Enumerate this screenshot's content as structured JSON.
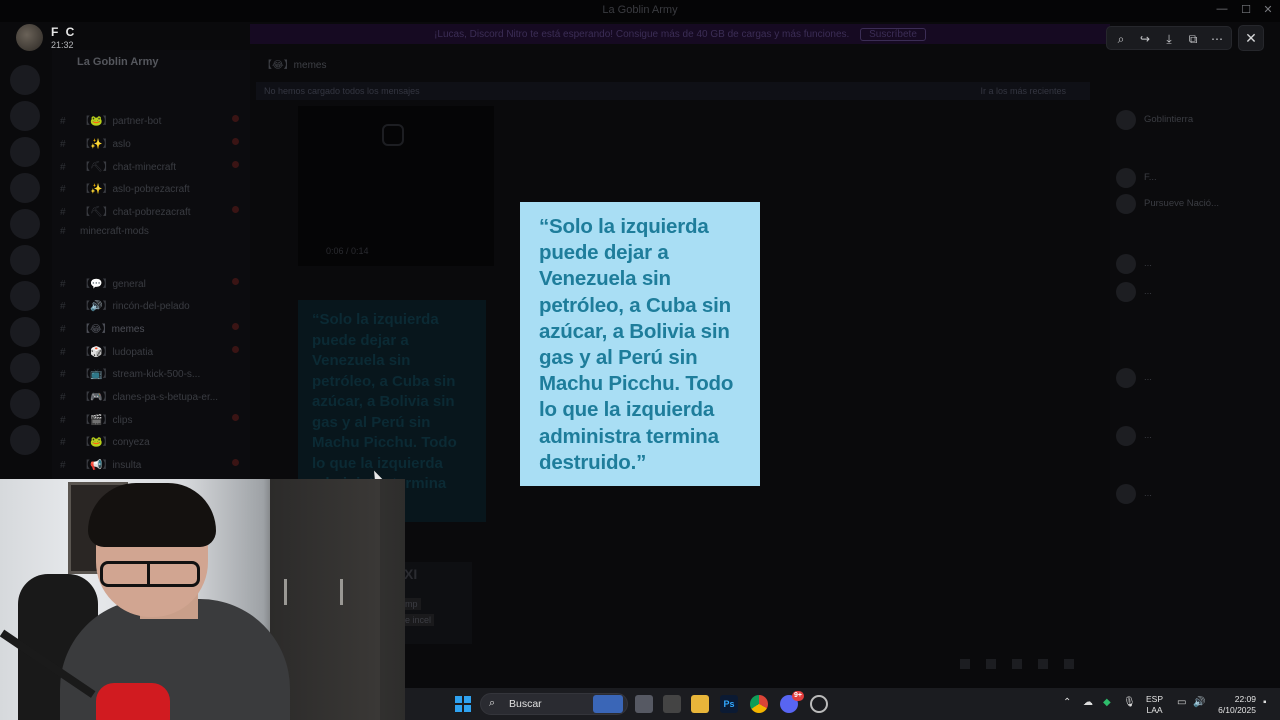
{
  "window": {
    "title": "La Goblin Army"
  },
  "banner": {
    "text": "¡Lucas, Discord Nitro te está esperando! Consigue más de 40 GB de cargas y más funciones.",
    "button": "Suscríbete"
  },
  "user_header": {
    "name": "F C",
    "time": "21:32"
  },
  "server": {
    "name": "La Goblin Army",
    "channels": [
      {
        "label": "【🐸】partner-bot"
      },
      {
        "label": "【✨】aslo"
      },
      {
        "label": "【⛏】chat-minecraft"
      },
      {
        "label": "【✨】aslo-pobrezacraft"
      },
      {
        "label": "【⛏】chat-pobrezacraft"
      },
      {
        "label": "minecraft-mods"
      },
      {
        "label": "【💬】general"
      },
      {
        "label": "【🔊】rincón-del-pelado"
      },
      {
        "label": "【😂】memes"
      },
      {
        "label": "【🎲】ludopatia"
      },
      {
        "label": "【📺】stream-kick-500-s..."
      },
      {
        "label": "【🎮】clanes-pa-s-betupa-er..."
      },
      {
        "label": "【🎬】clips"
      },
      {
        "label": "【🐸】conyeza"
      },
      {
        "label": "【📢】insulta"
      }
    ]
  },
  "chat": {
    "header": "【😂】memes",
    "strip_left": "No hemos cargado todos los mensajes",
    "strip_right": "Ir a los más recientes",
    "video_time": "0:06 / 0:14",
    "mini_quote": "“Solo la izquierda puede dejar a Venezuela sin petróleo, a Cuba sin azúcar, a Bolivia sin gas y al Perú sin Machu Picchu. Todo lo que la izquierda administra termina destruido.”",
    "small_card_title": "XI",
    "small_card_line1": "mp",
    "small_card_line2": "e incel"
  },
  "members": [
    {
      "name": "Goblintierra"
    },
    {
      "name": "F..."
    },
    {
      "name": "Pursueve Nació..."
    },
    {
      "name": "..."
    },
    {
      "name": "..."
    },
    {
      "name": "..."
    },
    {
      "name": "..."
    },
    {
      "name": "..."
    }
  ],
  "viewer": {
    "tools": [
      "zoom-icon",
      "share-icon",
      "download-icon",
      "open-external-icon",
      "more-icon"
    ],
    "close_label": "✕"
  },
  "image": {
    "quote": "“Solo la izquierda puede dejar a Venezuela sin petróleo, a Cuba sin azúcar, a Bolivia sin gas y al Perú sin Machu Picchu. Todo lo que la izquierda administra termina destruido.”",
    "background": "#a9def4",
    "text_color": "#1e7d9b"
  },
  "taskbar": {
    "search_placeholder": "Buscar",
    "lang_line1": "ESP",
    "lang_line2": "LAA",
    "time": "22:09",
    "date": "6/10/2025",
    "discord_badge": "9+"
  }
}
